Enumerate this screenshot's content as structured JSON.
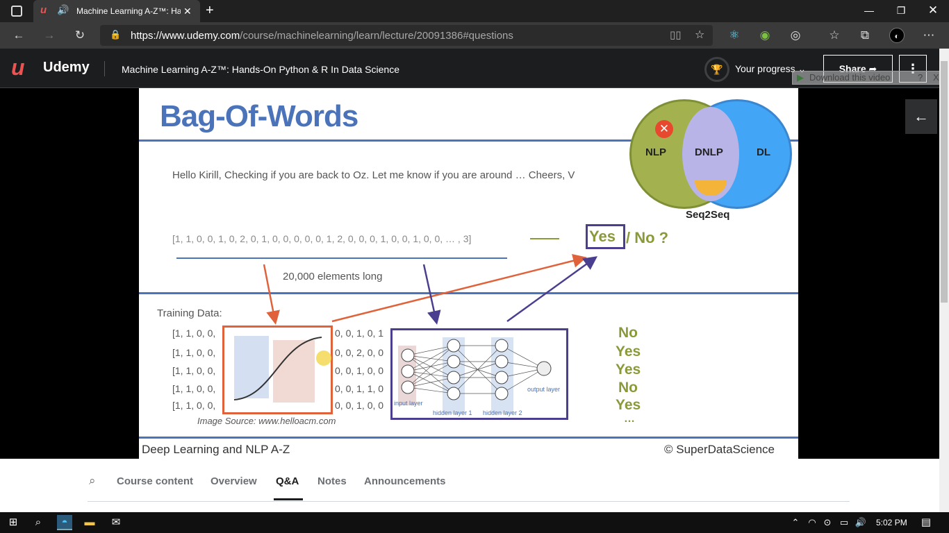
{
  "browser": {
    "tab_title": "Machine Learning A-Z™: Ha",
    "url_host": "https://www.udemy.com",
    "url_path": "/course/machinelearning/learn/lecture/20091386#questions"
  },
  "header": {
    "logo_text": "Udemy",
    "course_title": "Machine Learning A-Z™: Hands-On Python & R In Data Science",
    "progress_label": "Your progress",
    "share_label": "Share",
    "download_label": "Download this video"
  },
  "slide": {
    "title": "Bag-Of-Words",
    "email": "Hello Kirill, Checking if you are back to Oz. Let me know if you are around … Cheers, V",
    "vector": "[1, 1, 0, 0, 1, 0, 2, 0, 1, 0, 0, 0, 0, 0, 1, 2, 0, 0, 0, 1, 0, 0, 1, 0, 0, … , 3]",
    "length_label": "20,000 elements long",
    "question_yes": "Yes",
    "question_rest": "/ No ?",
    "venn": {
      "left": "NLP",
      "middle": "DNLP",
      "right": "DL",
      "bottom": "Seq2Seq"
    },
    "training_label": "Training Data:",
    "rows_left": [
      "[1, 1, 0, 0,",
      "[1, 1, 0, 0,",
      "[1, 1, 0, 0,",
      "[1, 1, 0, 0,",
      "[1, 1, 0, 0,"
    ],
    "rows_right": [
      "0, 0, 1, 0, 1",
      "0, 0, 2, 0, 0",
      "0, 0, 1, 0, 0",
      "0, 0, 1, 1, 0",
      "0, 0, 1, 0, 0"
    ],
    "answers": [
      "No",
      "Yes",
      "Yes",
      "No",
      "Yes"
    ],
    "answers_more": "…",
    "image_source": "Image Source: www.helloacm.com",
    "nn_labels": {
      "input": "input layer",
      "hidden1": "hidden layer 1",
      "hidden2": "hidden layer 2",
      "output": "output layer"
    },
    "footer_left": "Deep Learning and NLP A-Z",
    "footer_right": "© SuperDataScience"
  },
  "course_tabs": {
    "items": [
      "Course content",
      "Overview",
      "Q&A",
      "Notes",
      "Announcements"
    ],
    "active": "Q&A"
  },
  "taskbar": {
    "time": "5:02 PM"
  },
  "colors": {
    "udemy_red": "#ec5252",
    "slide_blue": "#4a73ba",
    "nn_purple": "#4a3f8f",
    "arrow_orange": "#e0623a"
  }
}
